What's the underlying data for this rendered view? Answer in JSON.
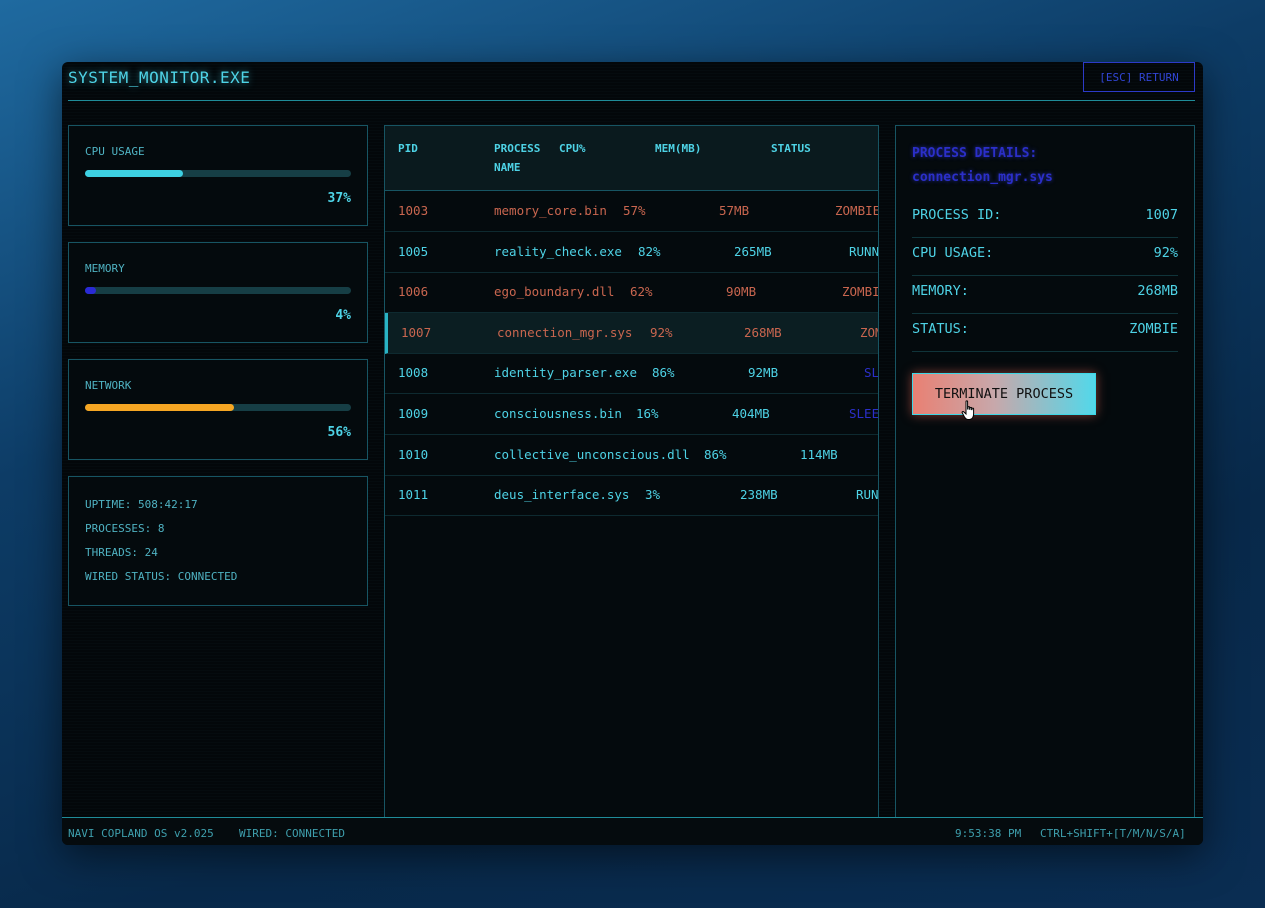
{
  "window": {
    "title": "SYSTEM_MONITOR.EXE",
    "return_label": "[ESC] RETURN"
  },
  "gauges": [
    {
      "label": "CPU USAGE",
      "value_text": "37%",
      "fill_percent": 37,
      "color": "#3dd0e2"
    },
    {
      "label": "MEMORY",
      "value_text": "4%",
      "fill_percent": 4,
      "color": "#2a2ad6"
    },
    {
      "label": "NETWORK",
      "value_text": "56%",
      "fill_percent": 56,
      "color": "#f5a623"
    }
  ],
  "system_info": {
    "uptime": "UPTIME: 508:42:17",
    "processes": "PROCESSES: 8",
    "threads": "THREADS: 24",
    "wired_status": "WIRED STATUS: CONNECTED"
  },
  "table": {
    "headers": {
      "pid": "PID",
      "process_line1": "PROCESS",
      "process_line2": "NAME",
      "cpu": "CPU%",
      "mem": "MEM(MB)",
      "status": "STATUS"
    },
    "rows": [
      {
        "pid": "1003",
        "name": "memory_core.bin",
        "cpu": "57%",
        "mem": "57MB",
        "status": "ZOMBIE",
        "state": "zombie"
      },
      {
        "pid": "1005",
        "name": "reality_check.exe",
        "cpu": "82%",
        "mem": "265MB",
        "status": "RUNN",
        "state": "running"
      },
      {
        "pid": "1006",
        "name": "ego_boundary.dll",
        "cpu": "62%",
        "mem": "90MB",
        "status": "ZOMBI",
        "state": "zombie"
      },
      {
        "pid": "1007",
        "name": "connection_mgr.sys",
        "cpu": "92%",
        "mem": "268MB",
        "status": "ZOM",
        "state": "zombie",
        "selected": true
      },
      {
        "pid": "1008",
        "name": "identity_parser.exe",
        "cpu": "86%",
        "mem": "92MB",
        "status": "SL",
        "state": "sleeping"
      },
      {
        "pid": "1009",
        "name": "consciousness.bin",
        "cpu": "16%",
        "mem": "404MB",
        "status": "SLEE",
        "state": "sleeping"
      },
      {
        "pid": "1010",
        "name": "collective_unconscious.dll",
        "cpu": "86%",
        "mem": "114MB",
        "status": "",
        "state": "running"
      },
      {
        "pid": "1011",
        "name": "deus_interface.sys",
        "cpu": "3%",
        "mem": "238MB",
        "status": "RUN",
        "state": "running"
      }
    ]
  },
  "details": {
    "heading": "PROCESS DETAILS:",
    "process_name": "connection_mgr.sys",
    "fields": [
      {
        "key": "PROCESS ID:",
        "value": "1007"
      },
      {
        "key": "CPU USAGE:",
        "value": "92%"
      },
      {
        "key": "MEMORY:",
        "value": "268MB"
      },
      {
        "key": "STATUS:",
        "value": "ZOMBIE"
      }
    ],
    "terminate_label": "TERMINATE PROCESS"
  },
  "footer": {
    "os_version": "NAVI COPLAND OS v2.025",
    "wired": "WIRED: CONNECTED",
    "clock": "9:53:38 PM",
    "shortcuts": "CTRL+SHIFT+[T/M/N/S/A]"
  },
  "colors": {
    "accent": "#4ed3e6",
    "zombie": "#c9664f",
    "sleeping": "#2b2fc9",
    "running": "#4ed3e6",
    "background": "#03070a"
  },
  "icons": {
    "pointer": "hand-pointer-icon"
  }
}
